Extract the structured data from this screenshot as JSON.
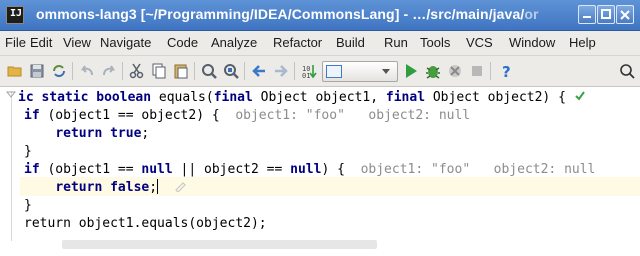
{
  "window": {
    "title_main": "ommons-lang3 [~/Programming/IDEA/CommonsLang] - …/src/main/java/",
    "title_faded": "or"
  },
  "menu": {
    "items": [
      "File",
      "Edit",
      "View",
      "Navigate",
      "Code",
      "Analyze",
      "Refactor",
      "Build",
      "Run",
      "Tools",
      "VCS",
      "Window",
      "Help"
    ]
  },
  "toolbar": {
    "icons": [
      "open-folder-icon",
      "save-icon",
      "sync-icon",
      "undo-icon",
      "redo-icon",
      "cut-icon",
      "copy-icon",
      "paste-icon",
      "find-icon",
      "replace-icon",
      "back-icon",
      "forward-icon",
      "build-icon",
      "run-config-dropdown",
      "run-icon",
      "debug-icon",
      "coverage-icon",
      "stop-icon",
      "help-icon",
      "search-icon"
    ],
    "colors": {
      "run": "#2e9e3f",
      "debug": "#3a8a3a",
      "stop": "#b0b0b0",
      "help": "#2b6fcf"
    }
  },
  "editor": {
    "lines": [
      {
        "code": "ic static boolean equals(final Object object1, final Object object2) {"
      },
      {
        "code": "if (object1 == object2) {",
        "hint": "object1: \"foo\"   object2: null"
      },
      {
        "code": "    return true;"
      },
      {
        "code": "}"
      },
      {
        "code": "if (object1 == null || object2 == null) {",
        "hint": "object1: \"foo\"   object2: null"
      },
      {
        "code": "    return false;"
      },
      {
        "code": "}"
      },
      {
        "code": "return object1.equals(object2);"
      }
    ],
    "caret_line_color": "#fffae3",
    "keyword_color": "#000080",
    "hint_color": "#8c8c8c"
  }
}
